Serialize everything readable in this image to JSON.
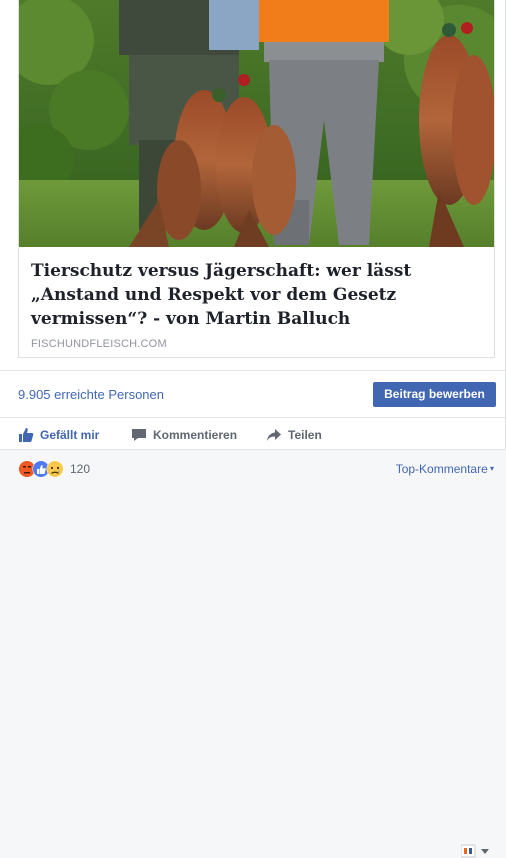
{
  "link_preview": {
    "title": "Tierschutz versus Jägerschaft: wer lässt „Anstand und Respekt vor dem Gesetz vermissen“? - von Martin Balluch",
    "domain": "FISCHUNDFLEISCH.COM",
    "image_subject": "pheasant-hunters-photo"
  },
  "reach": {
    "text": "9.905 erreichte Personen",
    "boost_label": "Beitrag bewerben"
  },
  "actions": {
    "like_label": "Gefällt mir",
    "comment_label": "Kommentieren",
    "share_label": "Teilen"
  },
  "reactions": {
    "icons": [
      "angry-icon",
      "like-icon",
      "sad-icon"
    ],
    "count": "120",
    "order_label": "Top-Kommentare"
  },
  "colors": {
    "accent": "#4267b2",
    "secondary_text": "#606770",
    "domain_text": "#90949c"
  }
}
